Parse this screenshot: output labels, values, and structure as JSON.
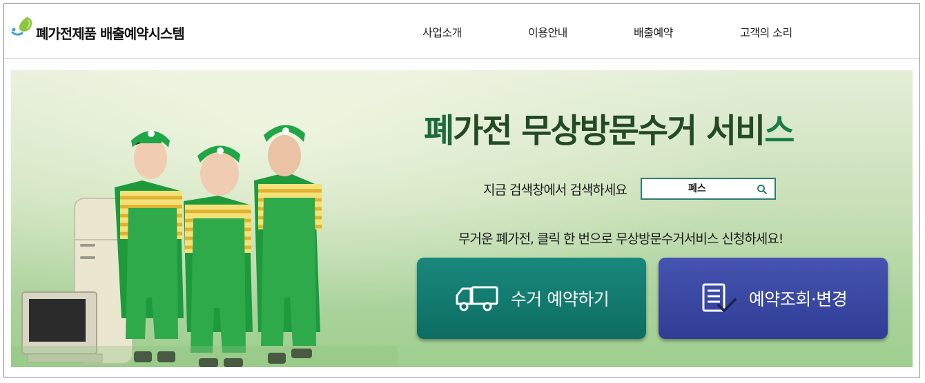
{
  "header": {
    "logo_text": "폐가전제품 배출예약시스템",
    "nav": [
      {
        "label": "사업소개"
      },
      {
        "label": "이용안내"
      },
      {
        "label": "배출예약"
      },
      {
        "label": "고객의 소리"
      }
    ]
  },
  "hero": {
    "headline": {
      "part1": "폐",
      "part2": "가전 무상방문수거 서비",
      "part3": "스"
    },
    "search": {
      "label": "지금 검색창에서 검색하세요",
      "value": "폐스"
    },
    "tagline": "무거운 폐가전, 클릭 한 번으로 무상방문수거서비스 신청하세요!",
    "buttons": {
      "collect_label": "수거 예약하기",
      "lookup_label": "예약조회·변경"
    }
  },
  "colors": {
    "accent_teal": "#0d6d62",
    "accent_blue": "#2f3d95",
    "headline_green": "#234a24"
  },
  "icons": {
    "logo": "leaf-drop-icon",
    "collect": "truck-icon",
    "lookup": "document-check-icon",
    "search": "search-icon"
  }
}
